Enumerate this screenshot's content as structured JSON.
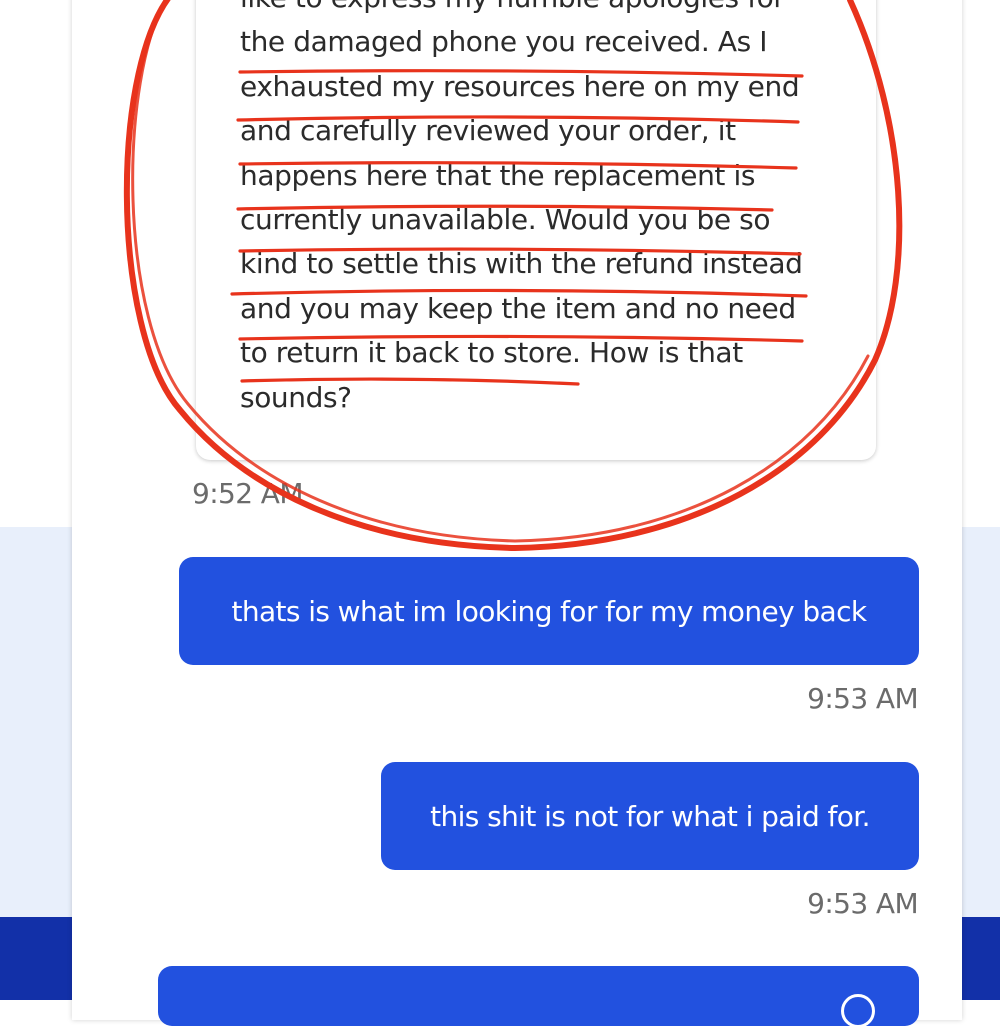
{
  "agent_message": {
    "lines": [
      "like to express my humble apologies for",
      "the damaged phone you received. As I",
      "exhausted my resources here on my end",
      "and carefully reviewed your order, it",
      "happens here that the replacement is",
      "currently unavailable. Would you be so",
      "kind to settle this with the refund instead",
      "and you may keep the item and no need",
      "to return it back to store. How is that",
      "sounds?"
    ],
    "time": "9:52 AM"
  },
  "user_messages": [
    {
      "text": "thats is what im looking for for my money back",
      "time": "9:53 AM"
    },
    {
      "text": "this shit is not for what i paid for.",
      "time": "9:53 AM"
    }
  ],
  "colors": {
    "user_bubble": "#2251df",
    "annotation_red": "#e8331c",
    "band_light": "#e8effb",
    "band_dark": "#1230a8"
  }
}
